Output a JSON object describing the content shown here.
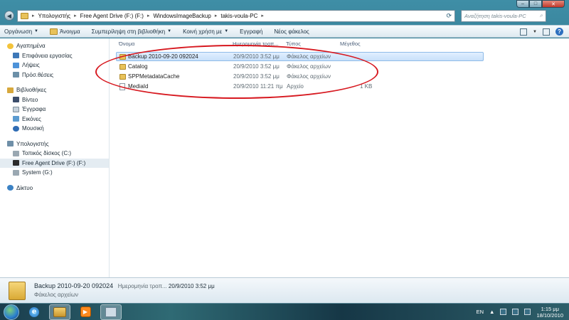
{
  "window": {
    "caption_min": "–",
    "caption_max": "□",
    "caption_close": "✕"
  },
  "address": {
    "crumbs": [
      "Υπολογιστής",
      "Free Agent Drive (F:) (F:)",
      "WindowsImageBackup",
      "takis-voula-PC"
    ],
    "search_placeholder": "Αναζήτηση takis-voula-PC"
  },
  "toolbar": {
    "organize": "Οργάνωση",
    "open": "Άνοιγμα",
    "include_library": "Συμπερίληψη στη βιβλιοθήκη",
    "share": "Κοινή χρήση με",
    "burn": "Εγγραφή",
    "new_folder": "Νέος φάκελος"
  },
  "nav": {
    "favorites": {
      "label": "Αγαπημένα",
      "items": [
        "Επιφάνεια εργασίας",
        "Λήψεις",
        "Πρόσ.θέσεις"
      ]
    },
    "libraries": {
      "label": "Βιβλιοθήκες",
      "items": [
        "Βίντεο",
        "Έγγραφα",
        "Εικόνες",
        "Μουσική"
      ]
    },
    "computer": {
      "label": "Υπολογιστής",
      "items": [
        "Τοπικός δίσκος (C:)",
        "Free Agent Drive (F:) (F:)",
        "System (G:)"
      ]
    },
    "network": {
      "label": "Δίκτυο"
    }
  },
  "columns": {
    "name": "Όνομα",
    "date": "Ημερομηνία τροπ...",
    "type": "Τύπος",
    "size": "Μέγεθος"
  },
  "files": [
    {
      "name": "Backup 2010-09-20 092024",
      "date": "20/9/2010 3:52 μμ",
      "type": "Φάκελος αρχείων",
      "size": "",
      "kind": "folder"
    },
    {
      "name": "Catalog",
      "date": "20/9/2010 3:52 μμ",
      "type": "Φάκελος αρχείων",
      "size": "",
      "kind": "folder"
    },
    {
      "name": "SPPMetadataCache",
      "date": "20/9/2010 3:52 μμ",
      "type": "Φάκελος αρχείων",
      "size": "",
      "kind": "folder"
    },
    {
      "name": "MediaId",
      "date": "20/9/2010 11:21 πμ",
      "type": "Αρχείο",
      "size": "1 KB",
      "kind": "file"
    }
  ],
  "details": {
    "name": "Backup 2010-09-20 092024",
    "date_label": "Ημερομηνία τροπ...",
    "date_value": "20/9/2010 3:52 μμ",
    "type": "Φάκελος αρχείων"
  },
  "taskbar": {
    "language": "EN",
    "time": "1:15 μμ",
    "date": "18/10/2010"
  }
}
